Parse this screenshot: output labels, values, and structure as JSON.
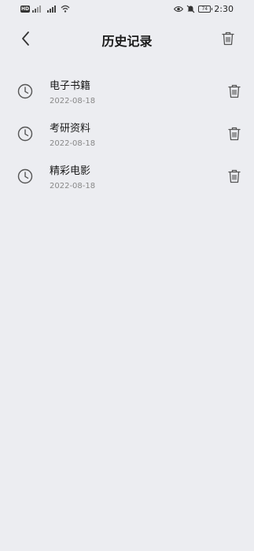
{
  "status_bar": {
    "hd_badge": "HD",
    "time": "2:30",
    "battery": "74",
    "icons": [
      "sim-hd-icon",
      "signal-icon",
      "signal-4g-icon",
      "wifi-icon",
      "eye-icon",
      "mute-icon",
      "battery-icon"
    ]
  },
  "header": {
    "title": "历史记录",
    "back_icon": "chevron-left-icon",
    "clear_icon": "trash-icon"
  },
  "history": {
    "items": [
      {
        "title": "电子书籍",
        "date": "2022-08-18"
      },
      {
        "title": "考研资料",
        "date": "2022-08-18"
      },
      {
        "title": "精彩电影",
        "date": "2022-08-18"
      }
    ]
  },
  "colors": {
    "background": "#ECEDF1",
    "text_primary": "#1a1a1a",
    "text_secondary": "#888888",
    "icon": "#555555"
  }
}
